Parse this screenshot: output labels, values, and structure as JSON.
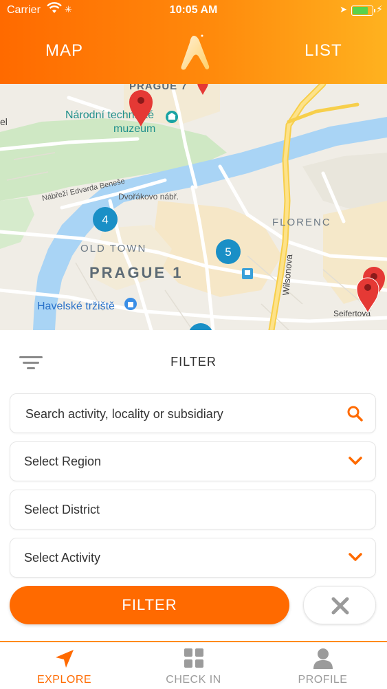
{
  "status_bar": {
    "carrier": "Carrier",
    "time": "10:05 AM"
  },
  "header": {
    "map_tab": "MAP",
    "list_tab": "LIST"
  },
  "map": {
    "labels": {
      "prague7": "PRAGUE 7",
      "museum_line1": "Národní technické",
      "museum_line2": "muzeum",
      "bridge_road": "Nábřeží Edvarda Beneše",
      "dvorakovo": "Dvořákovo nábř.",
      "florenc": "FLORENC",
      "old_town": "OLD TOWN",
      "prague1": "PRAGUE 1",
      "market": "Havelské tržiště",
      "wilsonova": "Wilsonova",
      "seifertova": "Seifertova",
      "edge_el": "el"
    },
    "clusters": {
      "cluster_a": "4",
      "cluster_b": "5"
    }
  },
  "filter": {
    "title": "FILTER",
    "search_placeholder": "Search activity, locality or subsidiary",
    "region": "Select Region",
    "district": "Select District",
    "activity": "Select Activity",
    "submit_label": "FILTER"
  },
  "tabbar": {
    "explore": "EXPLORE",
    "checkin": "CHECK IN",
    "profile": "PROFILE"
  },
  "colors": {
    "accent": "#ff6a00",
    "accent_light": "#ffb21f",
    "cluster": "#1a8fc6",
    "pin": "#e53935",
    "river": "#a9d4f5"
  },
  "icons": [
    "wifi-icon",
    "location-arrow-icon",
    "battery-icon",
    "app-logo",
    "filter-lines-icon",
    "search-icon",
    "chevron-down-icon",
    "close-icon",
    "navigation-arrow-icon",
    "grid-icon",
    "person-icon",
    "map-pin-icon",
    "museum-icon",
    "shopping-bag-icon",
    "metro-icon"
  ]
}
